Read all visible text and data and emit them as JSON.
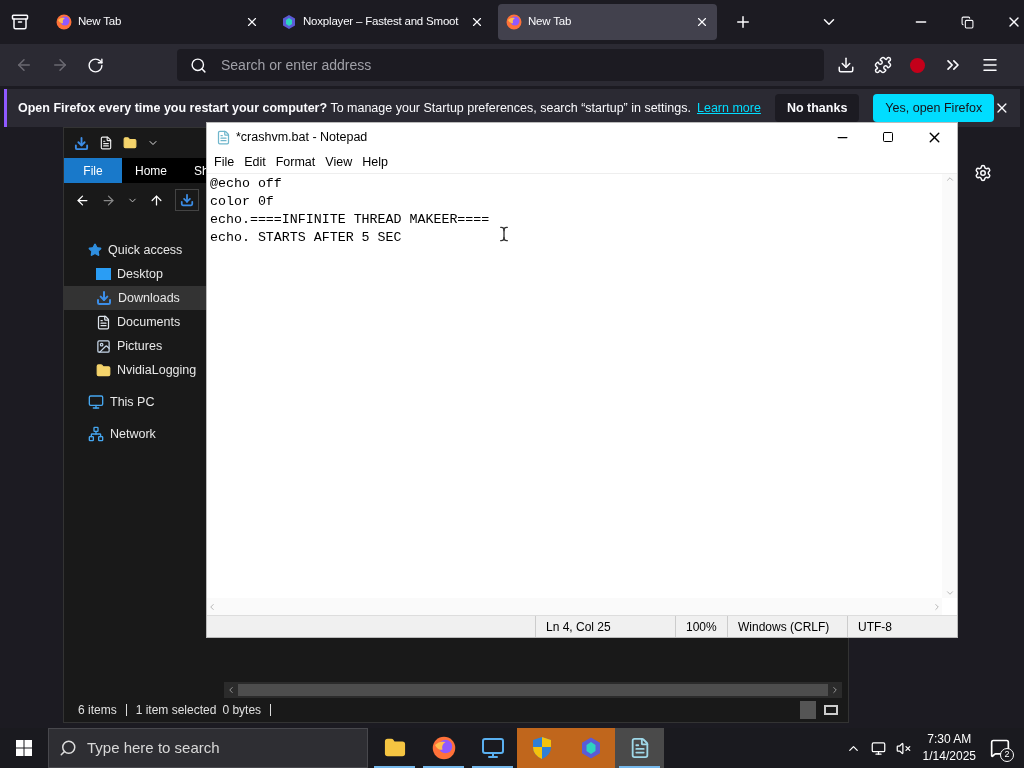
{
  "browser": {
    "tabs": [
      {
        "title": "New Tab",
        "kind": "firefox",
        "selected": false
      },
      {
        "title": "Noxplayer – Fastest and Smoot",
        "kind": "nox",
        "selected": false
      },
      {
        "title": "New Tab",
        "kind": "firefox",
        "selected": true
      }
    ],
    "address": {
      "placeholder": "Search or enter address"
    },
    "notification": {
      "bold": "Open Firefox every time you restart your computer?",
      "text": "To manage your Startup preferences, search “startup” in settings.",
      "link": "Learn more",
      "buttons": [
        {
          "label": "No thanks",
          "kind": "secondary"
        },
        {
          "label": "Yes, open Firefox",
          "kind": "primary"
        }
      ]
    }
  },
  "explorer": {
    "ribbon_tabs": [
      {
        "label": "File",
        "selected": true
      },
      {
        "label": "Home",
        "selected": false
      },
      {
        "label": "Sh",
        "selected": false
      }
    ],
    "sidebar": [
      {
        "label": "Quick access",
        "kind": "star",
        "selected": false,
        "children": [
          {
            "label": "Desktop",
            "kind": "desktop",
            "selected": false
          },
          {
            "label": "Downloads",
            "kind": "download",
            "selected": true
          },
          {
            "label": "Documents",
            "kind": "document",
            "selected": false
          },
          {
            "label": "Pictures",
            "kind": "picture",
            "selected": false
          },
          {
            "label": "NvidiaLogging",
            "kind": "folder",
            "selected": false
          }
        ]
      },
      {
        "label": "This PC",
        "kind": "pc",
        "selected": false
      },
      {
        "label": "Network",
        "kind": "network",
        "selected": false
      }
    ],
    "status": [
      "6 items",
      "1 item selected",
      "0 bytes"
    ]
  },
  "notepad": {
    "title": "*crashvm.bat - Notepad",
    "menu": [
      "File",
      "Edit",
      "Format",
      "View",
      "Help"
    ],
    "lines": [
      "@echo off",
      "color 0f",
      "echo.====INFINITE THREAD MAKEER====",
      "echo. STARTS AFTER 5 SEC"
    ],
    "status": [
      "Ln 4, Col 25",
      "100%",
      "Windows (CRLF)",
      "UTF-8"
    ]
  },
  "taskbar": {
    "search": {
      "placeholder": "Type here to search"
    },
    "apps": [
      {
        "kind": "explorer",
        "running": true,
        "flashing": false,
        "active": false
      },
      {
        "kind": "firefox",
        "running": true,
        "flashing": false,
        "active": false
      },
      {
        "kind": "remote",
        "running": true,
        "flashing": false,
        "active": false
      },
      {
        "kind": "shield",
        "running": false,
        "flashing": true,
        "active": false
      },
      {
        "kind": "nox",
        "running": false,
        "flashing": true,
        "active": false
      },
      {
        "kind": "notepad",
        "running": true,
        "flashing": false,
        "active": true
      }
    ],
    "time": "7:30 AM",
    "date": "1/14/2025",
    "notification_count": "2"
  }
}
